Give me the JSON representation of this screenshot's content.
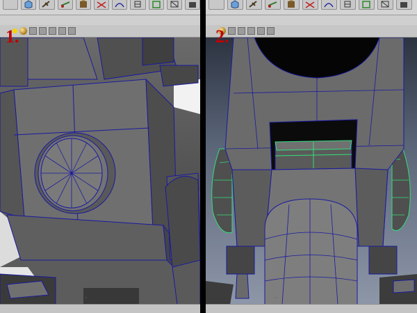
{
  "panels": [
    {
      "id": "p1",
      "step_label": "1.",
      "status_text": ""
    },
    {
      "id": "p2",
      "step_label": "2.",
      "status_text": ""
    }
  ],
  "shelf_icons": [
    "select-tool-icon",
    "poly-cube-icon",
    "lasso-icon",
    "move-icon",
    "transform-icon",
    "split-edge-icon",
    "curve-icon",
    "extrude-icon",
    "merge-icon",
    "bevel-icon",
    "render-icon"
  ],
  "view_bar_icons": [
    "light-icon",
    "shading-sphere-icon",
    "isolate-icon",
    "camera-icon",
    "xray-icon",
    "wireframe-icon",
    "grid-icon"
  ],
  "colors": {
    "wire": "#1a1aa0",
    "selection": "#33e07a",
    "label": "#c00000"
  }
}
